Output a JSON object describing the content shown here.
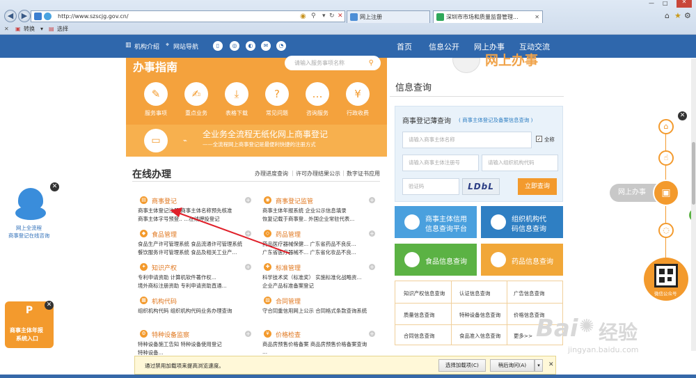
{
  "browser": {
    "url": "http://www.szscjg.gov.cn/",
    "tabs": [
      "网上注册",
      "深圳市市场和质量监督管理..."
    ],
    "cmd": {
      "convert": "转换",
      "select": "选择"
    }
  },
  "topnav": {
    "left": [
      "机构介绍",
      "网站导航"
    ],
    "main": [
      "首页",
      "信息公开",
      "网上办事",
      "互动交流"
    ],
    "header_banner": "网上办事"
  },
  "guide": {
    "title": "办事指南",
    "search_placeholder": "请输入服务事项名称",
    "items": [
      {
        "label": "服务事项",
        "glyph": "✎"
      },
      {
        "label": "重点业务",
        "glyph": "✍"
      },
      {
        "label": "表格下载",
        "glyph": "⤓"
      },
      {
        "label": "常见问题",
        "glyph": "?"
      },
      {
        "label": "咨询服务",
        "glyph": "…"
      },
      {
        "label": "行政收费",
        "glyph": "¥"
      }
    ],
    "banner_title": "全业务全流程无纸化网上商事登记",
    "banner_sub": "——全流程网上商事登记是最便利快捷的注册方式"
  },
  "online": {
    "title": "在线办理",
    "quick_links": [
      "办理进度查询",
      "许可办理结果公示",
      "数字证书应用"
    ],
    "cards": [
      {
        "title": "商事登记",
        "lines": [
          "商事主体登记注册  商事主体名称预先核准",
          "商事主体字号预登..  ...在线押投登记"
        ]
      },
      {
        "title": "商事登记监管",
        "lines": [
          "商事主体年报系统  企业公示信息填录",
          "恢复记载于商事登..  外国企业常驻代表..."
        ]
      },
      {
        "title": "食品管理",
        "lines": [
          "食品生产许可管理系统  食品流通许可管理系统",
          "餐饮服务许可管理系统  食品及相关工业产..."
        ]
      },
      {
        "title": "药品管理",
        "lines": [
          "药品医疗器械保健...  广东省药品不良反...",
          "广东省医疗器械不...  广东省化妆品不良..."
        ]
      },
      {
        "title": "知识产权",
        "lines": [
          "专利申请资助  计算机软件著作权...",
          "境外商标注册资助  专利申请资助直通..."
        ]
      },
      {
        "title": "标准管理",
        "lines": [
          "科学技术奖（标准奖）  实施标准化战略资...",
          "企业产品标准备案登记"
        ]
      },
      {
        "title": "机构代码",
        "lines": [
          "组织机构代码  组织机构代码业务办理查询"
        ]
      },
      {
        "title": "合同管理",
        "lines": [
          "守合同重信用网上公示  合同格式条款查询系统"
        ]
      },
      {
        "title": "特种设备监察",
        "lines": [
          "特种设备施工告知  特种设备使用登记",
          "特种设备..."
        ]
      },
      {
        "title": "价格检查",
        "lines": [
          "商品房预售价格备案  商品房预售价格备案查询",
          "..."
        ]
      }
    ]
  },
  "info": {
    "title": "信息查询",
    "query_title": "商事登记薄查询",
    "query_sub": "( 商事主体登记及备案信息查询 )",
    "name_placeholder": "请输入商事主体名称",
    "checkbox_label": "全称",
    "reg_placeholder": "请输入商事主体注册号",
    "org_placeholder": "请输入组织机构代码",
    "captcha_placeholder": "验证码",
    "captcha_text": "LDbL",
    "query_button": "立即查询",
    "tiles": [
      {
        "lines": [
          "商事主体信用",
          "信息查询平台"
        ],
        "color": "#4aa0de"
      },
      {
        "lines": [
          "组织机构代",
          "码信息查询"
        ],
        "color": "#2f7fc3"
      },
      {
        "lines": [
          "食品信息查询"
        ],
        "color": "#5bb244"
      },
      {
        "lines": [
          "药品信息查询"
        ],
        "color": "#f1a738"
      }
    ],
    "links": [
      [
        "知识产权信息查询",
        "认证信息查询",
        "广告信息查询"
      ],
      [
        "质量信息查询",
        "特种设备信息查询",
        "价格信息查询"
      ],
      [
        "合同信息查询",
        "食品准入信息查询",
        "更多>>"
      ]
    ]
  },
  "float": {
    "qq_text": [
      "网上全流程",
      "商事登记在线咨询"
    ],
    "annual_text": [
      "商事主体年报",
      "系统入口"
    ],
    "right_label": "网上办事",
    "wechat": "微信公众号"
  },
  "notification": {
    "text": "通过禁用加载项来提高浏览速度。",
    "choose": "选择加载项(C)",
    "later": "稍后询问(A)"
  },
  "watermark": {
    "brand": "Bai",
    "brand2": "经验",
    "url": "jingyan.baidu.com"
  }
}
